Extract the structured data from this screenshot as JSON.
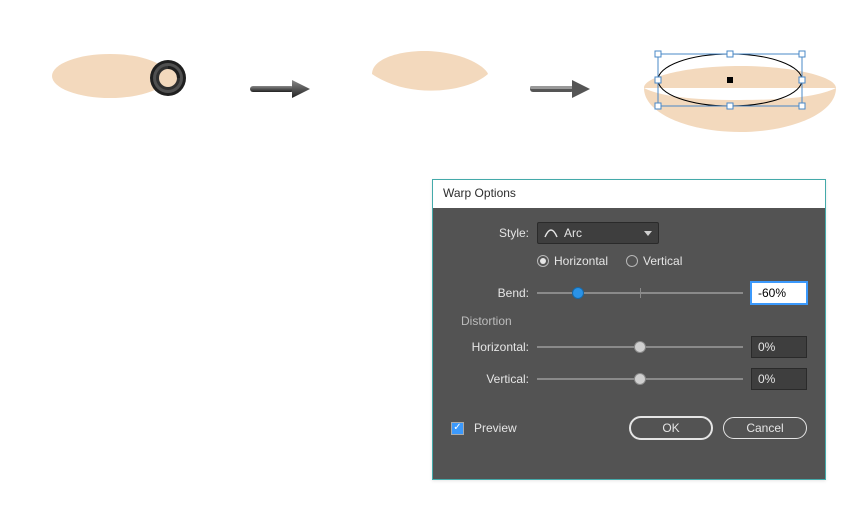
{
  "dialog": {
    "title": "Warp Options",
    "style_label": "Style:",
    "style_value": "Arc",
    "orientation": {
      "horizontal_label": "Horizontal",
      "vertical_label": "Vertical",
      "selected": "horizontal"
    },
    "bend": {
      "label": "Bend:",
      "value": "-60%",
      "thumb_pct": 20
    },
    "distortion": {
      "section_label": "Distortion",
      "horizontal": {
        "label": "Horizontal:",
        "value": "0%",
        "thumb_pct": 50
      },
      "vertical": {
        "label": "Vertical:",
        "value": "0%",
        "thumb_pct": 50
      }
    },
    "preview_label": "Preview",
    "preview_checked": true,
    "ok_label": "OK",
    "cancel_label": "Cancel"
  },
  "colors": {
    "shape_fill": "#f3d9bd",
    "dialog_bg": "#535353",
    "accent": "#2a92e6"
  }
}
